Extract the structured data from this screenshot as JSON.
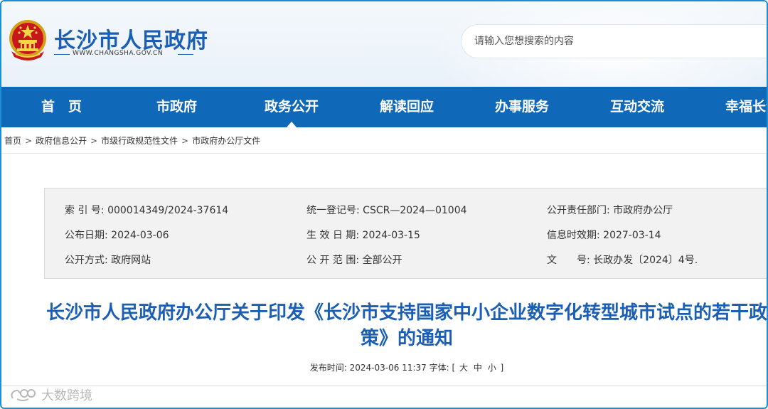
{
  "header": {
    "site_title": "长沙市人民政府",
    "site_url": "WWW.CHANGSHA.GOV.CN",
    "search_placeholder": "请输入您想搜索的内容"
  },
  "nav": {
    "items": [
      {
        "label": "首　页"
      },
      {
        "label": "市政府"
      },
      {
        "label": "政务公开"
      },
      {
        "label": "解读回应"
      },
      {
        "label": "办事服务"
      },
      {
        "label": "互动交流"
      },
      {
        "label": "幸福长沙"
      }
    ],
    "active_index": 2
  },
  "breadcrumb": {
    "items": [
      "首页",
      "政府信息公开",
      "市级行政规范性文件",
      "市政府办公厅文件"
    ],
    "separator": ">"
  },
  "info": {
    "index_label": "索 引 号:",
    "index_value": "000014349/2024-37614",
    "reg_label": "统一登记号:",
    "reg_value": "CSCR—2024—01004",
    "dept_label": "公开责任部门:",
    "dept_value": "市政府办公厅",
    "pub_date_label": "公布日期:",
    "pub_date_value": "2024-03-06",
    "eff_date_label": "生 效 日 期:",
    "eff_date_value": "2024-03-15",
    "exp_date_label": "信息时效期:",
    "exp_date_value": "2027-03-14",
    "mode_label": "公开方式:",
    "mode_value": "政府网站",
    "scope_label": "公 开 范 围:",
    "scope_value": "全部公开",
    "docno_label": "文　　号:",
    "docno_value": "长政办发〔2024〕4号."
  },
  "document": {
    "title": "长沙市人民政府办公厅关于印发《长沙市支持国家中小企业数字化转型城市试点的若干政策》的通知",
    "publish_label": "发布时间:",
    "publish_time": "2024-03-06 11:37",
    "font_label": "字体:",
    "font_open": "[",
    "font_large": "大",
    "font_medium": "中",
    "font_small": "小",
    "font_close": "]"
  },
  "watermark": {
    "text": "大数跨境"
  },
  "colors": {
    "brand_blue": "#1a5fb4",
    "nav_blue": "#1068b8",
    "frame_blue": "#1d8fd6",
    "info_bg": "#f2f2f2"
  }
}
